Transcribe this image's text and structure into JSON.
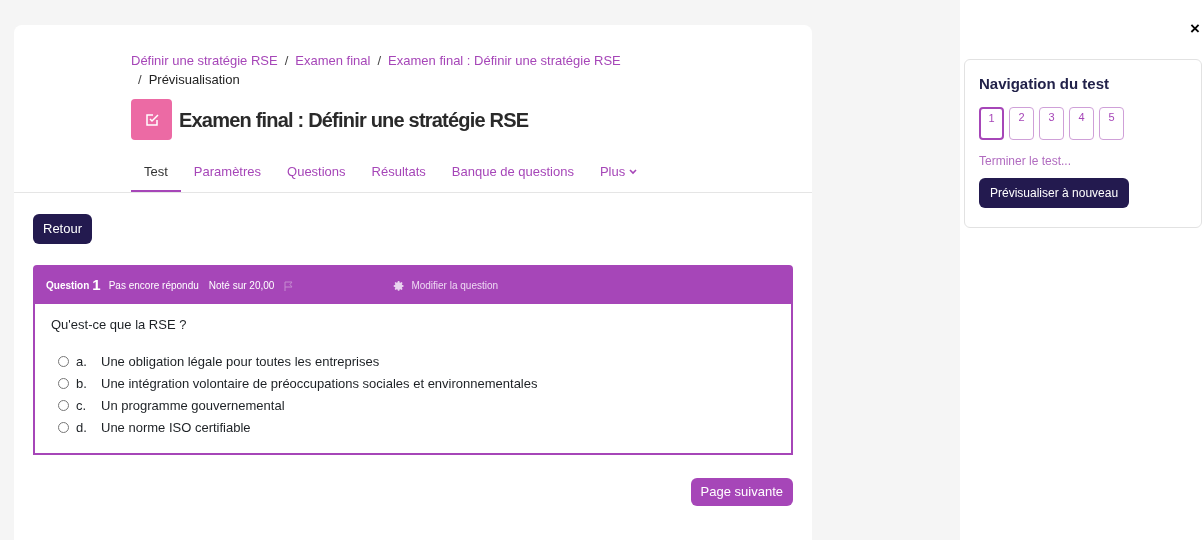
{
  "breadcrumb": [
    {
      "label": "Définir une stratégie RSE",
      "kind": "link"
    },
    {
      "separator": "/",
      "label": "Examen final",
      "kind": "link"
    },
    {
      "separator": "/",
      "label": "Examen final : Définir une stratégie RSE",
      "kind": "link"
    },
    {
      "separator": "/",
      "label": "Prévisualisation",
      "kind": "current"
    }
  ],
  "title": "Examen final : Définir une stratégie RSE",
  "tabs": [
    {
      "label": "Test",
      "selected": true
    },
    {
      "label": "Paramètres",
      "selected": false
    },
    {
      "label": "Questions",
      "selected": false
    },
    {
      "label": "Résultats",
      "selected": false
    },
    {
      "label": "Banque de questions",
      "selected": false
    },
    {
      "label": "Plus",
      "selected": false,
      "dropdown": true
    }
  ],
  "back_button": "Retour",
  "question": {
    "label": "Question",
    "number": "1",
    "status": "Pas encore répondu",
    "grade": "Noté sur 20,00",
    "flagged": false,
    "edit_link": "Modifier la question",
    "text": "Qu'est-ce que la RSE ?",
    "answers": [
      {
        "letter": "a.",
        "text": "Une obligation légale pour toutes les entreprises",
        "selected": false
      },
      {
        "letter": "b.",
        "text": "Une intégration volontaire de préoccupations sociales et environnementales",
        "selected": false
      },
      {
        "letter": "c.",
        "text": "Un programme gouvernemental",
        "selected": false
      },
      {
        "letter": "d.",
        "text": "Une norme ISO certifiable",
        "selected": false
      }
    ]
  },
  "next_button": "Page suivante",
  "close": "×",
  "navigation": {
    "title": "Navigation du test",
    "questions": [
      {
        "label": "1",
        "selected": true
      },
      {
        "label": "2",
        "selected": false
      },
      {
        "label": "3",
        "selected": false
      },
      {
        "label": "4",
        "selected": false
      },
      {
        "label": "5",
        "selected": false
      }
    ],
    "finish_link": "Terminer le test...",
    "restart_button": "Prévisualiser à nouveau"
  }
}
